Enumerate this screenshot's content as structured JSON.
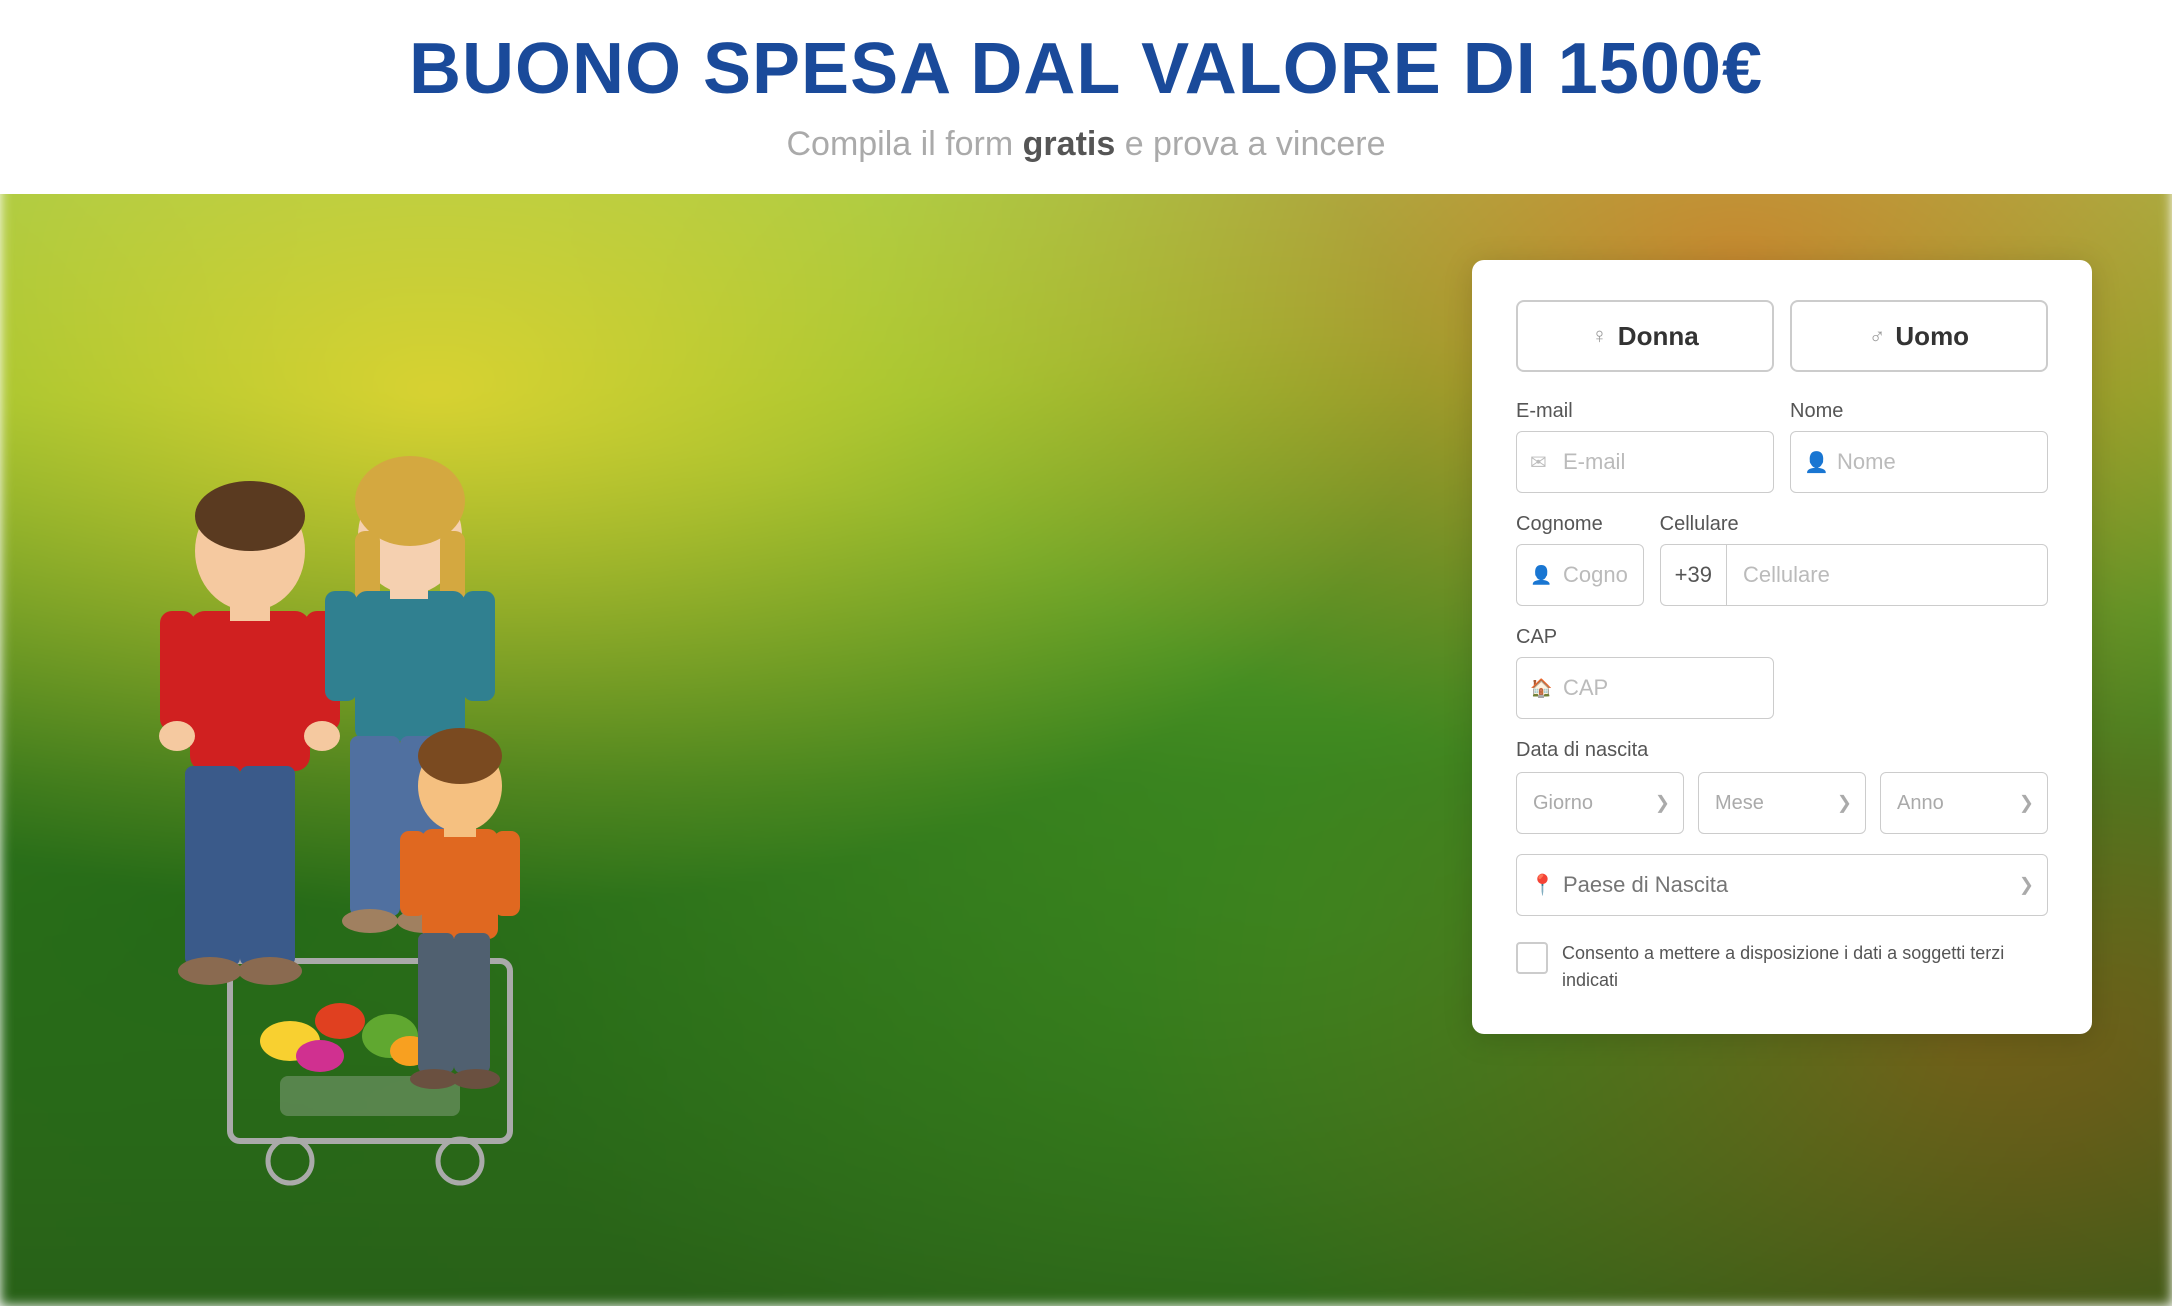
{
  "header": {
    "title": "BUONO SPESA DAL VALORE DI 1500€",
    "subtitle_plain": "Compila il form ",
    "subtitle_bold": "gratis",
    "subtitle_rest": " e prova a vincere"
  },
  "form": {
    "gender_donna": "Donna",
    "gender_uomo": "Uomo",
    "email_label": "E-mail",
    "email_placeholder": "E-mail",
    "nome_label": "Nome",
    "nome_placeholder": "Nome",
    "cognome_label": "Cognome",
    "cognome_placeholder": "Cognome",
    "cellulare_label": "Cellulare",
    "cellulare_prefix": "+39",
    "cellulare_placeholder": "Cellulare",
    "cap_label": "CAP",
    "cap_placeholder": "CAP",
    "dob_label": "Data di nascita",
    "dob_giorno": "Giorno",
    "dob_mese": "Mese",
    "dob_anno": "Anno",
    "paese_placeholder": "Paese di Nascita",
    "consent_text": "Consento a mettere a disposizione i dati a soggetti terzi indicati"
  },
  "icons": {
    "donna": "♀",
    "uomo": "♂",
    "email": "✉",
    "nome": "👤",
    "cognome": "👤+",
    "cap": "🏠",
    "paese": "📍",
    "chevron": "❯"
  }
}
